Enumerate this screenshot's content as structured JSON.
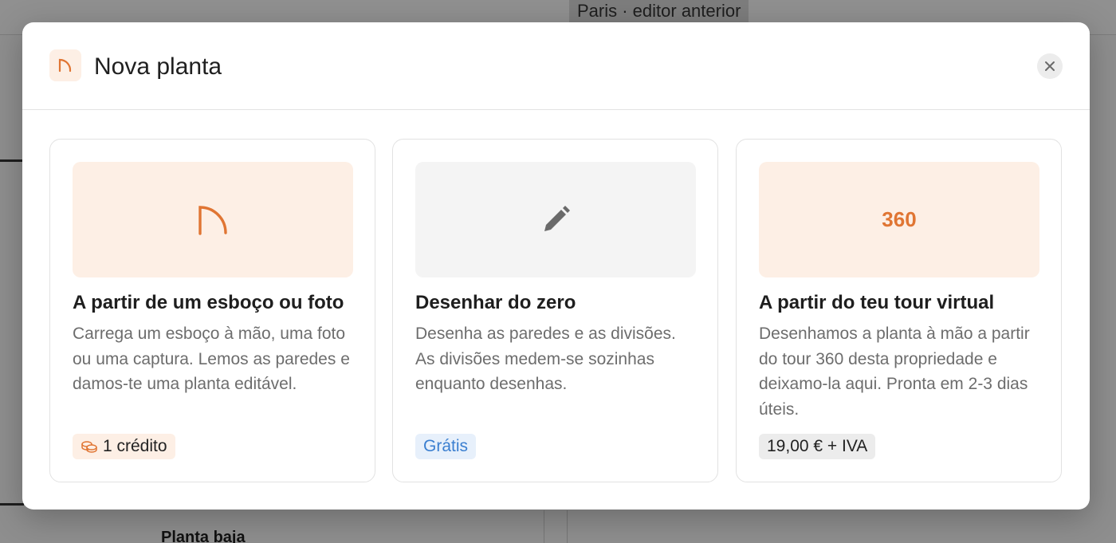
{
  "background": {
    "breadcrumb": "Paris · editor anterior",
    "floor_label": "Planta baja"
  },
  "modal": {
    "title": "Nova planta",
    "header_icon": "arc-icon",
    "close_icon": "close-icon"
  },
  "cards": [
    {
      "visual_icon": "arc-icon",
      "title": "A partir de um esboço ou foto",
      "description": "Carrega um esboço à mão, uma foto ou uma captura. Lemos as paredes e damos-te uma planta editável.",
      "badge_icon": "coins-icon",
      "badge": "1 crédito"
    },
    {
      "visual_icon": "pencil-icon",
      "title": "Desenhar do zero",
      "description": "Desenha as paredes e as divisões. As divisões medem-se sozinhas enquanto desenhas.",
      "badge": "Grátis"
    },
    {
      "visual_text": "360",
      "title": "A partir do teu tour virtual",
      "description": "Desenhamos a planta à mão a partir do tour 360 desta propriedade e deixamo-la aqui. Pronta em 2-3 dias úteis.",
      "badge": "19,00 € + IVA"
    }
  ],
  "colors": {
    "accent": "#e07533",
    "accent_soft": "#fdefe5",
    "free_text": "#3b7fd0",
    "free_bg": "#e7f0fb"
  }
}
